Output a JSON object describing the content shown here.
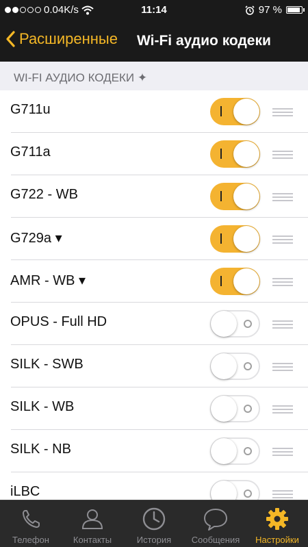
{
  "status": {
    "carrier_speed": "0.04K/s",
    "time": "11:14",
    "battery_percent": "97 %",
    "signal_bars": 2,
    "battery_level": 0.97
  },
  "nav": {
    "back_label": "Расширенные",
    "title": "Wi-Fi аудио кодеки"
  },
  "section": {
    "header": "WI-FI АУДИО КОДЕКИ ✦"
  },
  "codecs": [
    {
      "label": "G711u",
      "enabled": true
    },
    {
      "label": "G711a",
      "enabled": true
    },
    {
      "label": "G722 - WB",
      "enabled": true
    },
    {
      "label": "G729a ▾",
      "enabled": true
    },
    {
      "label": "AMR - WB ▾",
      "enabled": true
    },
    {
      "label": "OPUS - Full HD",
      "enabled": false
    },
    {
      "label": "SILK - SWB",
      "enabled": false
    },
    {
      "label": "SILK - WB",
      "enabled": false
    },
    {
      "label": "SILK - NB",
      "enabled": false
    },
    {
      "label": "iLBC",
      "enabled": false
    }
  ],
  "tabs": [
    {
      "label": "Телефон",
      "icon": "phone-icon",
      "active": false
    },
    {
      "label": "Контакты",
      "icon": "contacts-icon",
      "active": false
    },
    {
      "label": "История",
      "icon": "clock-icon",
      "active": false
    },
    {
      "label": "Сообщения",
      "icon": "message-bubble-icon",
      "active": false
    },
    {
      "label": "Настройки",
      "icon": "gear-icon",
      "active": true
    }
  ],
  "colors": {
    "accent": "#f4b726",
    "switch_on": "#f4b331",
    "bar_background": "#1a1a1a",
    "tab_inactive": "#8e8e93"
  }
}
